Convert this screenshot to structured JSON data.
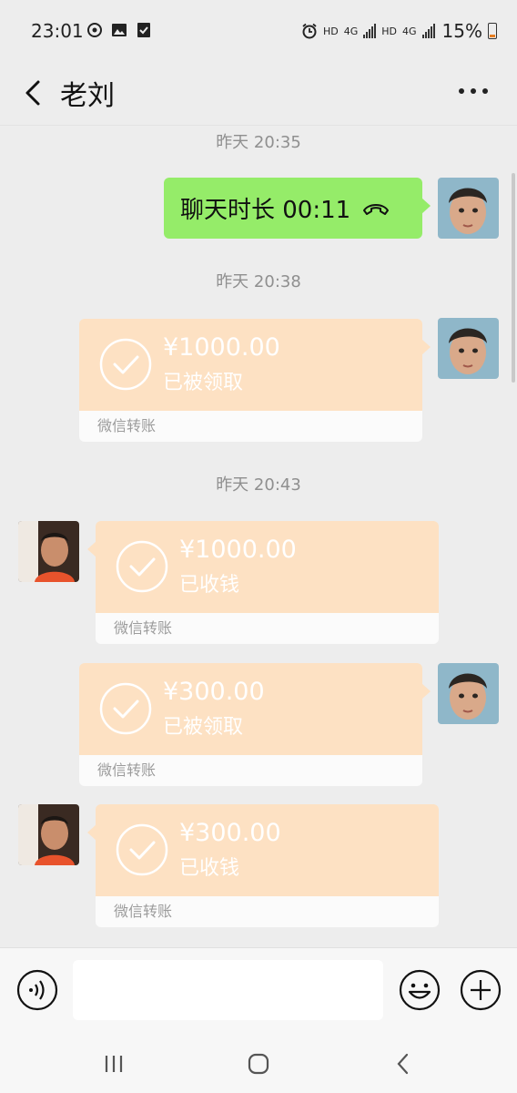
{
  "status_bar": {
    "time": "23:01",
    "hd1": "HD",
    "net1": "4G",
    "hd2": "HD",
    "net2": "4G",
    "battery": "15%"
  },
  "header": {
    "title": "老刘"
  },
  "messages": {
    "ts1": "昨天 20:35",
    "call_text": "聊天时长 00:11",
    "ts2": "昨天 20:38",
    "ts3": "昨天 20:43",
    "transfers": [
      {
        "amount": "¥1000.00",
        "status": "已被领取",
        "label": "微信转账",
        "side": "right"
      },
      {
        "amount": "¥1000.00",
        "status": "已收钱",
        "label": "微信转账",
        "side": "left"
      },
      {
        "amount": "¥300.00",
        "status": "已被领取",
        "label": "微信转账",
        "side": "right"
      },
      {
        "amount": "¥300.00",
        "status": "已收钱",
        "label": "微信转账",
        "side": "left"
      }
    ]
  },
  "input": {
    "value": "",
    "placeholder": ""
  },
  "icons": {
    "back": "back-arrow-icon",
    "more": "more-dots-icon",
    "call": "phone-hangup-icon",
    "check": "check-circle-icon",
    "voice": "voice-icon",
    "emoji": "emoji-icon",
    "plus": "plus-icon"
  },
  "colors": {
    "background": "#ededed",
    "call_bubble": "#95ec69",
    "transfer_bubble": "#fde1c3"
  }
}
